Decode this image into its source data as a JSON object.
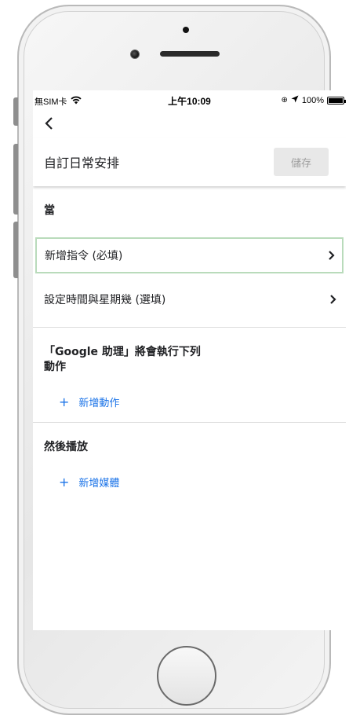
{
  "status_bar": {
    "carrier": "無SIM卡",
    "time": "上午10:09",
    "battery": "100%"
  },
  "header": {
    "title": "自訂日常安排",
    "save_label": "儲存"
  },
  "when_section": {
    "label": "當",
    "add_command": "新增指令 (必填)",
    "set_time": "設定時間與星期幾 (選填)"
  },
  "actions_section": {
    "label": "「Google 助理」將會執行下列動作",
    "add_action": "新增動作"
  },
  "media_section": {
    "label": "然後播放",
    "add_media": "新增媒體"
  },
  "icons": {
    "back": "chevron-left-icon",
    "chevron": "chevron-right-icon",
    "plus": "plus-icon",
    "wifi": "wifi-icon",
    "location": "location-arrow-icon",
    "battery": "battery-icon"
  },
  "colors": {
    "accent": "#1a73e8",
    "focus_border": "#b9dbbb",
    "save_bg": "#e8e8e8"
  }
}
